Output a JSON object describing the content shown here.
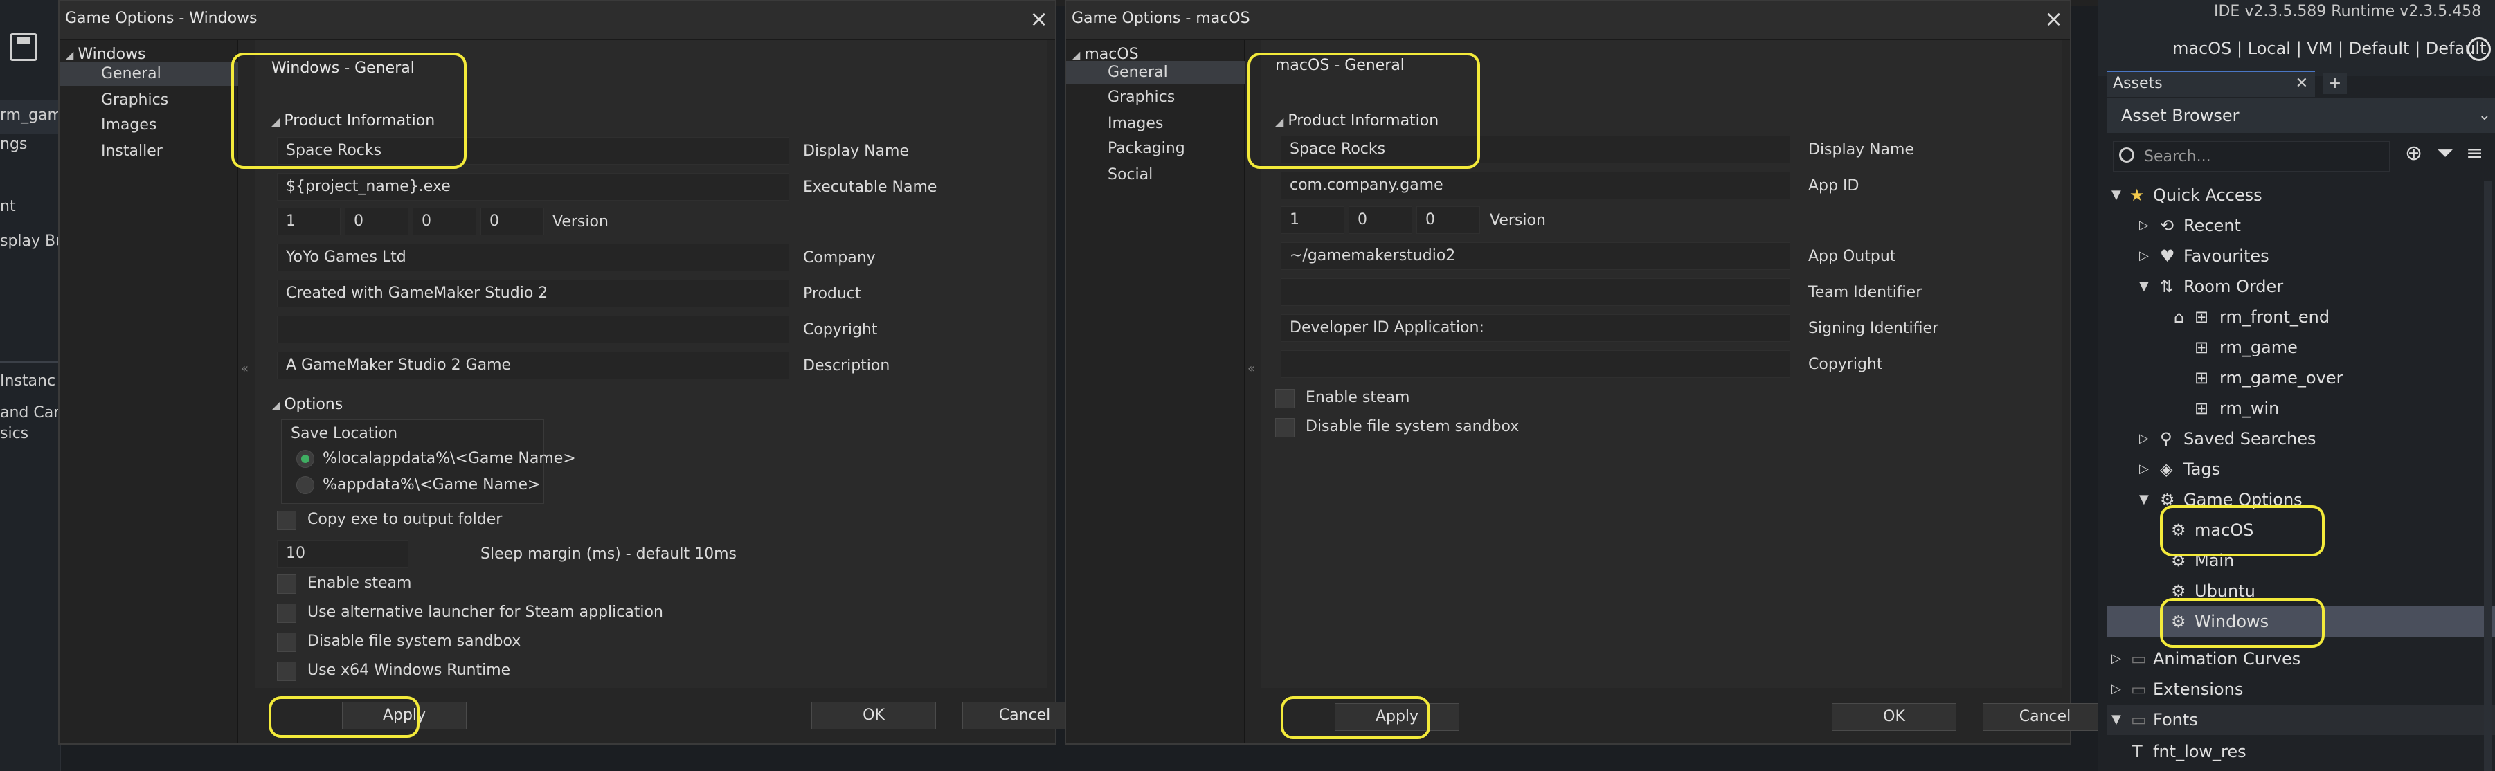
{
  "background": {
    "fragments": [
      "rm_gam",
      "ngs",
      "nt",
      "splay Bu",
      "Instanc",
      "and Car",
      "sics"
    ]
  },
  "win_dialog": {
    "title": "Game Options - Windows",
    "nav_root": "Windows",
    "nav_items": [
      "General",
      "Graphics",
      "Images",
      "Installer"
    ],
    "section_title": "Windows - General",
    "product_info_title": "Product Information",
    "fields": [
      {
        "value": "Space Rocks",
        "label": "Display Name"
      },
      {
        "value": "${project_name}.exe",
        "label": "Executable Name"
      },
      {
        "value": "YoYo Games Ltd",
        "label": "Company"
      },
      {
        "value": "Created with GameMaker Studio 2",
        "label": "Product"
      },
      {
        "value": "",
        "label": "Copyright"
      },
      {
        "value": "A GameMaker Studio 2 Game",
        "label": "Description"
      }
    ],
    "version": [
      "1",
      "0",
      "0",
      "0"
    ],
    "version_label": "Version",
    "options_title": "Options",
    "save_location_title": "Save Location",
    "save_locations": [
      "%localappdata%\\<Game Name>",
      "%appdata%\\<Game Name>"
    ],
    "copy_exe_label": "Copy exe to output folder",
    "sleep_value": "10",
    "sleep_label": "Sleep margin (ms) - default 10ms",
    "checkboxes": [
      "Enable steam",
      "Use alternative launcher for Steam application",
      "Disable file system sandbox",
      "Use x64 Windows Runtime"
    ],
    "apply": "Apply",
    "ok": "OK",
    "cancel": "Cancel"
  },
  "mac_dialog": {
    "title": "Game Options - macOS",
    "nav_root": "macOS",
    "nav_items": [
      "General",
      "Graphics",
      "Images",
      "Packaging",
      "Social"
    ],
    "section_title": "macOS - General",
    "product_info_title": "Product Information",
    "fields": [
      {
        "value": "Space Rocks",
        "label": "Display Name"
      },
      {
        "value": "com.company.game",
        "label": "App ID"
      },
      {
        "value": "~/gamemakerstudio2",
        "label": "App Output"
      },
      {
        "value": "",
        "label": "Team Identifier"
      },
      {
        "value": "Developer ID Application:",
        "label": "Signing Identifier"
      },
      {
        "value": "",
        "label": "Copyright"
      }
    ],
    "version": [
      "1",
      "0",
      "0"
    ],
    "version_label": "Version",
    "checkboxes": [
      "Enable steam",
      "Disable file system sandbox"
    ],
    "apply": "Apply",
    "ok": "OK",
    "cancel": "Cancel"
  },
  "ide": {
    "version_text": "IDE v2.3.5.589  Runtime v2.3.5.458",
    "target_text": "macOS | Local | VM | Default | Default",
    "assets_tab": "Assets",
    "asset_browser": "Asset Browser",
    "search_placeholder": "Search...",
    "tree": [
      "Quick Access",
      "Recent",
      "Favourites",
      "Room Order",
      "rm_front_end",
      "rm_game",
      "rm_game_over",
      "rm_win",
      "Saved Searches",
      "Tags",
      "Game Options",
      "macOS",
      "Main",
      "Ubuntu",
      "Windows",
      "Animation Curves",
      "Extensions",
      "Fonts",
      "fnt_low_res"
    ]
  },
  "colors": {
    "highlight": "#f3ea3a",
    "selected_row": "#4a4f5c",
    "radio_on": "#3fae62",
    "tab_accent": "#4a76c4"
  }
}
